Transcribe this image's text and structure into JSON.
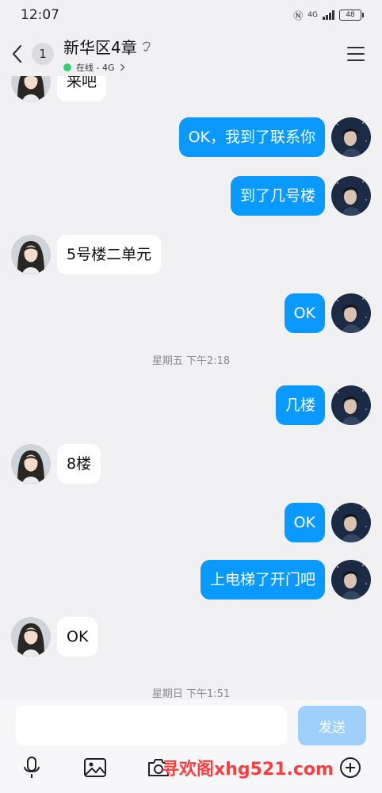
{
  "status_bar": {
    "time": "12:07",
    "network": "4G",
    "battery": "48"
  },
  "header": {
    "unread_count": "1",
    "title": "新华区4章",
    "presence": "在线 - 4G"
  },
  "messages": [
    {
      "side": "in",
      "text": "来吧"
    },
    {
      "side": "out",
      "text": "OK，我到了联系你"
    },
    {
      "side": "out",
      "text": "到了几号楼"
    },
    {
      "side": "in",
      "text": "5号楼二单元"
    },
    {
      "side": "out",
      "text": "OK"
    },
    {
      "side": "out",
      "text": "几楼"
    },
    {
      "side": "in",
      "text": "8楼"
    },
    {
      "side": "out",
      "text": "OK"
    },
    {
      "side": "out",
      "text": "上电梯了开门吧"
    },
    {
      "side": "in",
      "text": "OK"
    }
  ],
  "timestamps": [
    "星期五 下午2:18",
    "星期日 下午1:51"
  ],
  "input": {
    "value": "",
    "send_label": "发送"
  },
  "toolbar": [
    "mic-icon",
    "image-icon",
    "camera-icon",
    "plus-icon"
  ],
  "watermark": "寻欢阁xhg521.com",
  "colors": {
    "outgoing_bubble": "#0a99ff",
    "incoming_bubble": "#ffffff",
    "send_button": "#9fd0fb",
    "online_dot": "#2fd27a"
  }
}
